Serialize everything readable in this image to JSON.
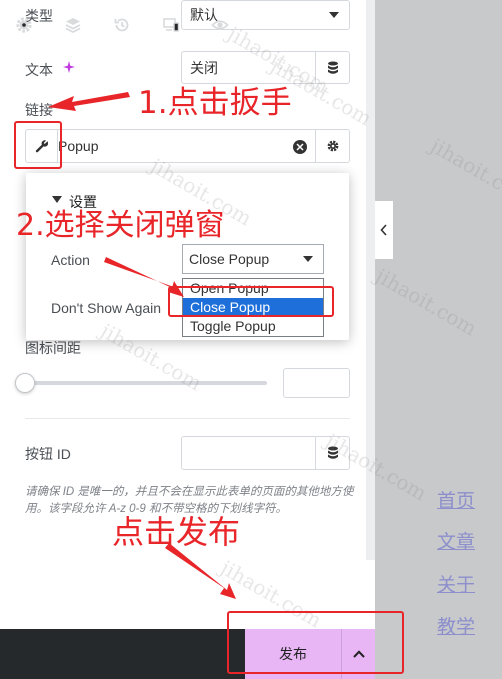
{
  "fields": {
    "type_label": "类型",
    "type_value": "默认",
    "text_label": "文本",
    "text_value": "关闭",
    "link_label": "链接",
    "link_value": "Popup",
    "icon_spacing_label": "图标间距",
    "button_id_label": "按钮 ID",
    "hint": "请确保 ID 是唯一的，并且不会在显示此表单的页面的其他地方使用。该字段允许 A-z 0-9 和不带空格的下划线字符。"
  },
  "popover": {
    "section_title": "设置",
    "action_label": "Action",
    "action_value": "Close Popup",
    "dont_show_label": "Don't Show Again",
    "options": [
      "Open Popup",
      "Close Popup",
      "Toggle Popup"
    ],
    "selected_index": 1
  },
  "bottombar": {
    "publish_label": "发布"
  },
  "side_links": [
    "首页",
    "文章",
    "关于",
    "教学"
  ],
  "annotations": {
    "step1": "1.点击扳手",
    "step2": "2.选择关闭弹窗",
    "step3": "点击发布"
  },
  "watermark": "jihaoit.com",
  "colors": {
    "annotation": "#e8262a",
    "publish_bg": "#e8b6f5",
    "selected_option": "#1e6fd9",
    "link": "#8c8fcc"
  }
}
